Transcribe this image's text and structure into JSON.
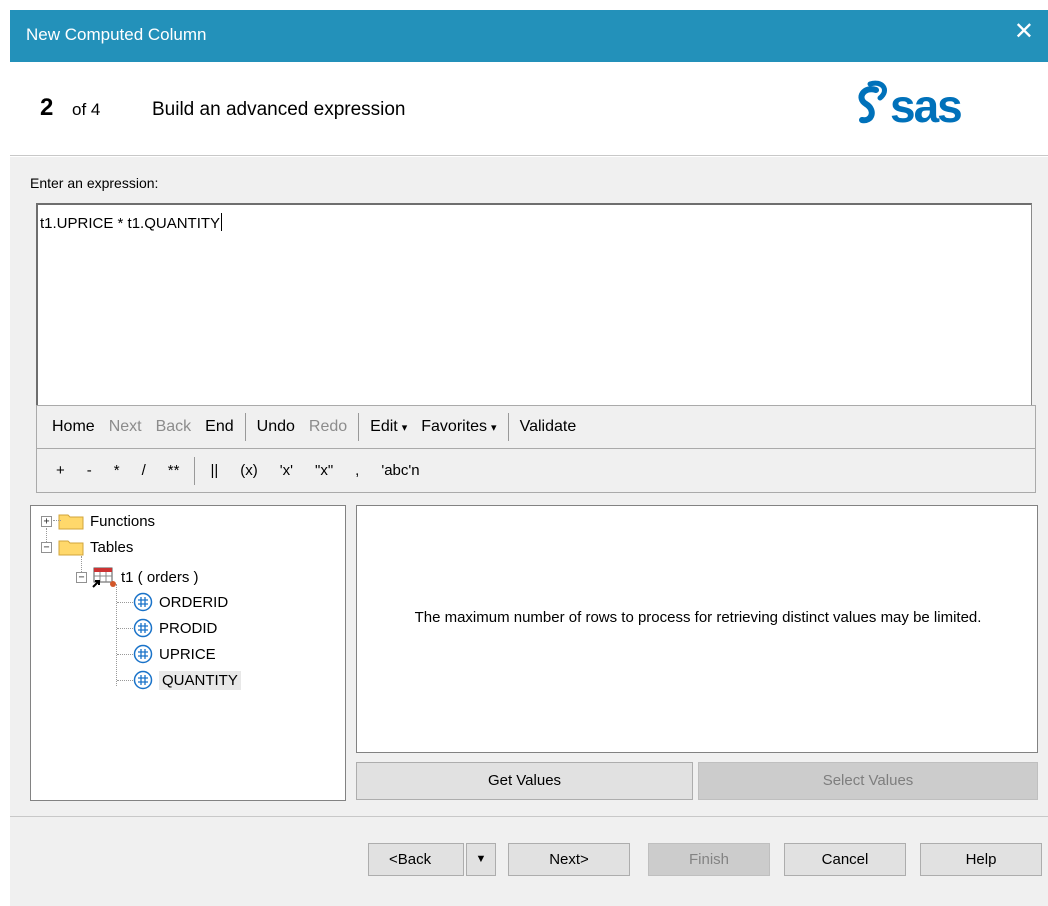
{
  "window": {
    "title": "New Computed Column",
    "close_glyph": "✕"
  },
  "step": {
    "number": "2",
    "of": "of 4",
    "title": "Build an advanced expression"
  },
  "logo": {
    "text": "sas",
    "color": "#0071ba"
  },
  "expression": {
    "label": "Enter an expression:",
    "value": "t1.UPRICE * t1.QUANTITY"
  },
  "toolbar": {
    "home": "Home",
    "next": "Next",
    "back": "Back",
    "end": "End",
    "undo": "Undo",
    "redo": "Redo",
    "edit": "Edit",
    "favorites": "Favorites",
    "validate": "Validate",
    "dropdown_glyph": "▾"
  },
  "operators": [
    "+",
    "-",
    "*",
    "/",
    "**",
    "||",
    "(x)",
    "'x'",
    "\"x\"",
    ",",
    "'abc'n"
  ],
  "tree": {
    "functions": "Functions",
    "tables": "Tables",
    "table_node": "t1 ( orders )",
    "columns": [
      "ORDERID",
      "PRODID",
      "UPRICE",
      "QUANTITY"
    ]
  },
  "info": {
    "message": "The maximum number of rows to process for retrieving distinct values may be limited.",
    "get_values": "Get Values",
    "select_values": "Select Values"
  },
  "footer": {
    "back": "<Back",
    "back_dropdown": "▼",
    "next": "Next>",
    "finish": "Finish",
    "cancel": "Cancel",
    "help": "Help"
  },
  "colors": {
    "titlebar": "#2391ba",
    "column_icon": "#1a73c9",
    "folder": "#ffd86b"
  }
}
